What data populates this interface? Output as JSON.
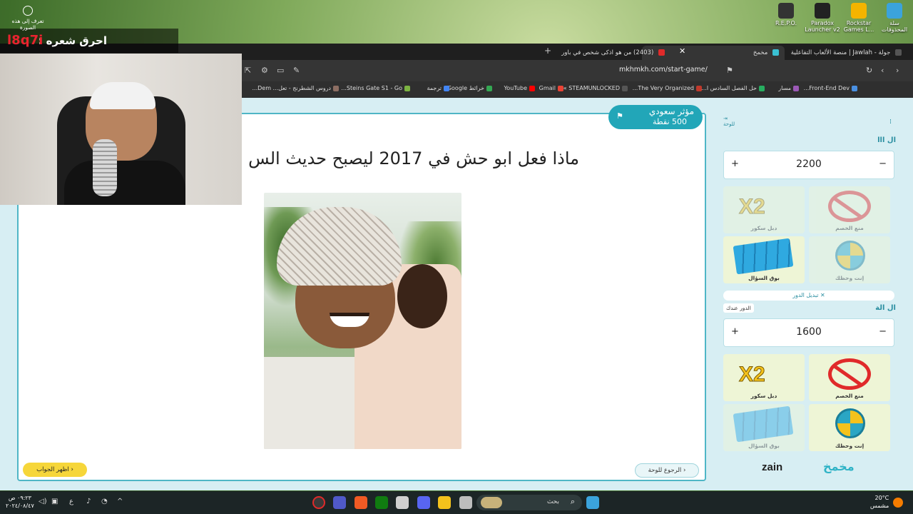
{
  "desktop": {
    "icons": [
      {
        "label": "R.E.P.O.",
        "color": "#333"
      },
      {
        "label": "Paradox Launcher v2",
        "color": "#222"
      },
      {
        "label": "Rockstar Games L...",
        "color": "#f4b400"
      },
      {
        "label": "سلة المحذوفات",
        "color": "#3ba3dc"
      }
    ]
  },
  "browser": {
    "tabs": [
      {
        "label": "جولة - Jawlah | منصة الألعاب التفاعلية",
        "active": false
      },
      {
        "label": "مخمخ",
        "active": true
      },
      {
        "label": "(2403) من هو اذكى شخص في باور",
        "active": false
      }
    ],
    "url": "mkhmkh.com/start-game/",
    "bookmarks": [
      "Front-End Dev...",
      "مسار",
      "حل الفصل السادس ا...",
      "The Very Organized...",
      "STEAMUNLOCKED »...",
      "Gmail",
      "YouTube",
      "خرائط Google",
      "ترجمة",
      "Steins Gate S1 - Go...",
      "دروس الشطرنج - تعل...",
      "Dem..."
    ]
  },
  "game": {
    "question": "ماذا فعل ابو حش في 2017 ليصبح حديث الس",
    "current_team": {
      "name": "مؤثر سعودي",
      "points": "500 نقطة"
    },
    "back_button": "الرجوع للوحة",
    "show_answer_button": "اظهر الجواب"
  },
  "sidebar": {
    "board_label": "للوحة",
    "team1": {
      "name": "ال ااا",
      "score": "2200"
    },
    "team2": {
      "name": "ال الة",
      "score": "1600",
      "turn_tag": "الدور عندك"
    },
    "switch_turn": "تبديل الدور",
    "tools": [
      "دبل سكور",
      "منع الخصم",
      "بوق السؤال",
      "إنت وحظك"
    ],
    "plus": "+",
    "minus": "−",
    "sponsor": "zain",
    "brand": "مخمخ"
  },
  "stream": {
    "overlay_text": "احرق شعره :",
    "code": "l8q7i",
    "identify_label": "تعرف إلى هذه الصورة"
  },
  "taskbar": {
    "search_placeholder": "بحث",
    "time": "٠٩:٢٣ ص",
    "date": "٢٠٢٤/٠٨/٤٧",
    "temperature": "20°C",
    "weather": "مشمس",
    "lang": "ع"
  }
}
